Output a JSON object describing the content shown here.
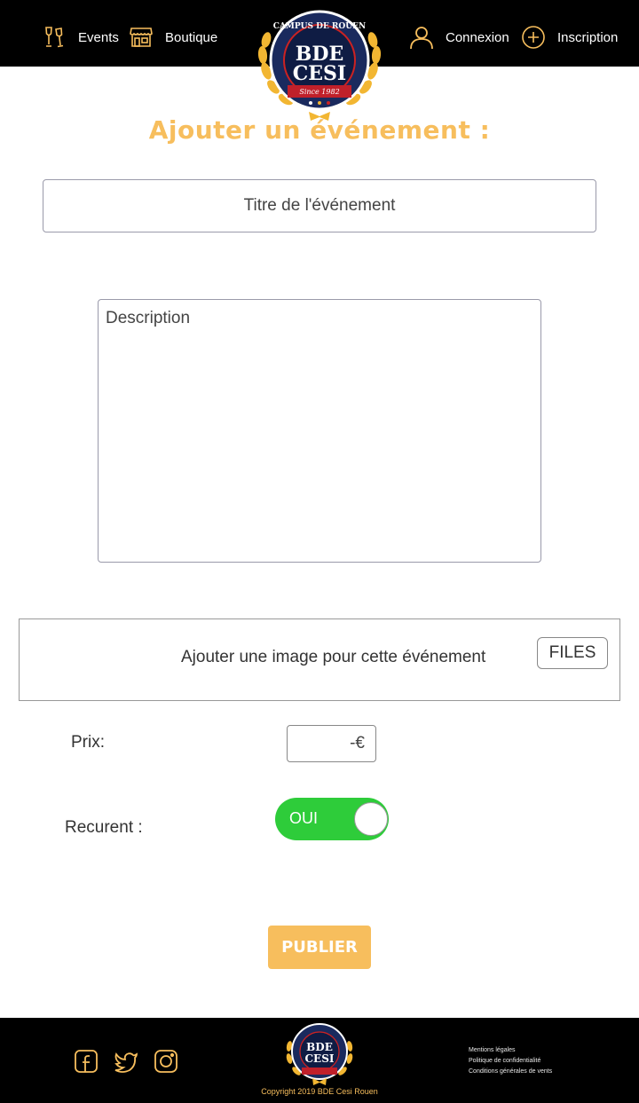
{
  "colors": {
    "accent": "#f7be5d",
    "header_bg": "#000000",
    "toggle_on": "#2ecc3a"
  },
  "header": {
    "nav": {
      "events": {
        "label": "Events",
        "icon": "champagne-glasses-icon"
      },
      "boutique": {
        "label": "Boutique",
        "icon": "store-icon"
      },
      "connexion": {
        "label": "Connexion",
        "icon": "user-icon"
      },
      "inscription": {
        "label": "Inscription",
        "icon": "plus-circle-icon"
      }
    },
    "logo": {
      "top_text": "CAMPUS DE ROUEN",
      "line1": "BDE",
      "line2": "CESI",
      "ribbon": "Since 1982"
    }
  },
  "main": {
    "title": "Ajouter un événement :",
    "title_input_placeholder": "Titre de l'événement",
    "description_placeholder": "Description",
    "image_label": "Ajouter une image pour cette événement",
    "files_button": "FILES",
    "prix_label": "Prix:",
    "prix_placeholder": "-€",
    "recurent_label": "Recurent :",
    "recurent_toggle": "OUI",
    "publish_button": "PUBLIER"
  },
  "footer": {
    "social": [
      "facebook-icon",
      "twitter-icon",
      "instagram-icon"
    ],
    "copyright": "Copyright 2019 BDE Cesi Rouen",
    "legal_links": [
      "Mentions légales",
      "Politique de confidentialité",
      "Conditions générales de vents"
    ]
  }
}
